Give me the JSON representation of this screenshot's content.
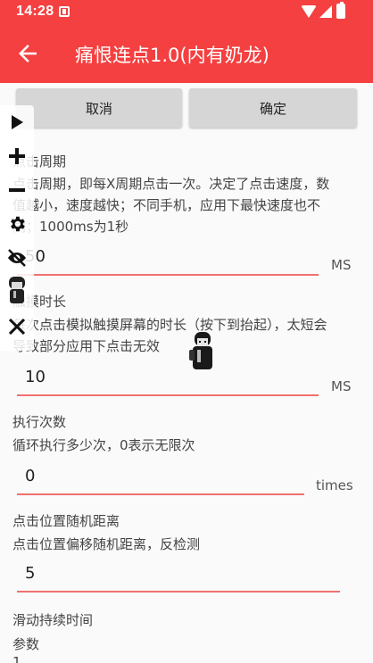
{
  "status_bar": {
    "time": "14:28"
  },
  "app_bar": {
    "title": "痛恨连点1.0(内有奶龙)"
  },
  "actions": {
    "cancel_label": "取消",
    "confirm_label": "确定"
  },
  "sections": [
    {
      "title": "点击周期",
      "desc_line1": "点击周期，即每X周期点击一次。决定了点击速度，数",
      "desc_line2": "值越小，速度越快；不同手机，应用下最快速度也不",
      "desc_line3": "同；1000ms为1秒",
      "value": "50",
      "unit": "MS"
    },
    {
      "title": "触摸时长",
      "desc_line1": "每次点击模拟触摸屏幕的时长（按下到抬起），太短会",
      "desc_line2": "导致部分应用下点击无效",
      "value": "10",
      "unit": "MS"
    },
    {
      "title": "执行次数",
      "desc_line1": "循环执行多少次，0表示无限次",
      "value": "0",
      "unit": "times"
    },
    {
      "title": "点击位置随机距离",
      "desc_line1": "点击位置偏移随机距离，反检测",
      "value": "5"
    },
    {
      "title": "滑动持续时间",
      "desc_line1": "参数",
      "desc_line2": "1"
    }
  ],
  "floating_toolbar": {
    "icons": [
      "play-icon",
      "plus-icon",
      "minus-icon",
      "gear-icon",
      "eye-off-icon",
      "character-icon",
      "close-icon"
    ]
  },
  "colors": {
    "accent": "#f44040",
    "underline": "#f07070",
    "button_bg": "#d6d6d6"
  }
}
